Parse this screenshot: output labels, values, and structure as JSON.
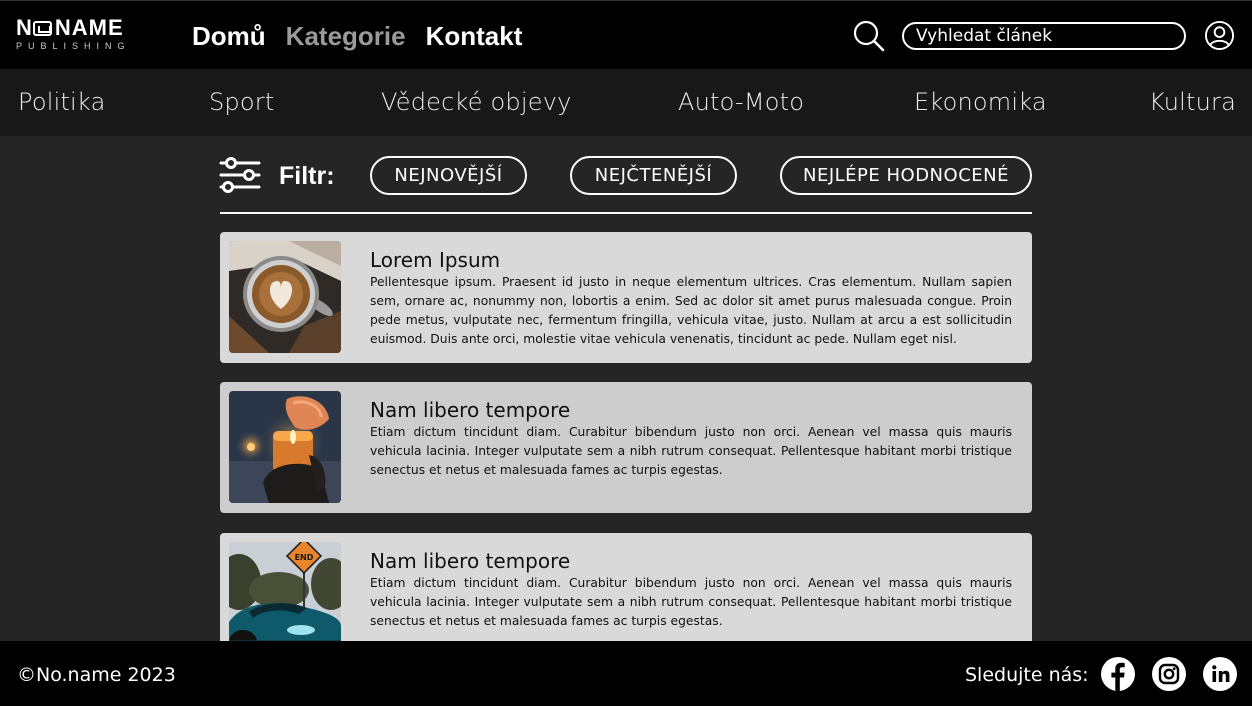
{
  "header": {
    "logo": {
      "line1_left": "N",
      "line1_right": "NAME",
      "line2": "PUBLISHING"
    },
    "nav": [
      {
        "label": "Domů",
        "state": "active"
      },
      {
        "label": "Kategorie",
        "state": "muted"
      },
      {
        "label": "Kontakt",
        "state": "active"
      }
    ],
    "search": {
      "placeholder": "Vyhledat článek",
      "icon": "search-icon"
    },
    "user_icon": "user-icon"
  },
  "categories": [
    "Politika",
    "Sport",
    "Vědecké objevy",
    "Auto-Moto",
    "Ekonomika",
    "Kultura"
  ],
  "filter": {
    "label": "Filtr:",
    "icon": "sliders-icon",
    "options": [
      "NEJNOVĚJŠÍ",
      "NEJČTENĚJŠÍ",
      "NEJLÉPE HODNOCENÉ"
    ]
  },
  "articles": [
    {
      "title": "Lorem Ipsum",
      "text": "Pellentesque ipsum. Praesent id justo in neque elementum ultrices. Cras elementum. Nullam sapien sem, ornare ac, nonummy non, lobortis a enim. Sed ac dolor sit amet purus malesuada congue. Proin pede metus, vulputate nec, fermentum fringilla, vehicula vitae, justo. Nullam at arcu a est sollicitudin euismod. Duis ante orci, molestie vitae vehicula venenatis, tincidunt ac pede. Nullam eget nisl.",
      "image": "coffee-latte-art"
    },
    {
      "title": "Nam libero tempore",
      "text": "Etiam dictum tincidunt diam. Curabitur bibendum justo non orci. Aenean vel massa quis mauris vehicula lacinia. Integer vulputate sem a nibh rutrum consequat. Pellentesque habitant morbi tristique senectus et netus et malesuada fames ac turpis egestas.",
      "image": "candle-in-hands"
    },
    {
      "title": "Nam libero tempore",
      "text": "Etiam dictum tincidunt diam. Curabitur bibendum justo non orci. Aenean vel massa quis mauris vehicula lacinia. Integer vulputate sem a nibh rutrum consequat. Pellentesque habitant morbi tristique senectus et netus et malesuada fames ac turpis egestas.",
      "image": "car-end-sign",
      "sign_text": "END"
    }
  ],
  "footer": {
    "copyright": "©No.name 2023",
    "follow_label": "Sledujte nás:",
    "social": [
      "facebook-icon",
      "instagram-icon",
      "linkedin-icon"
    ]
  },
  "colors": {
    "header_bg": "#000000",
    "category_bar_bg": "#181818",
    "page_bg": "#252525",
    "card_bg": "#d9d9d9",
    "muted_nav": "#9a9a9a"
  }
}
